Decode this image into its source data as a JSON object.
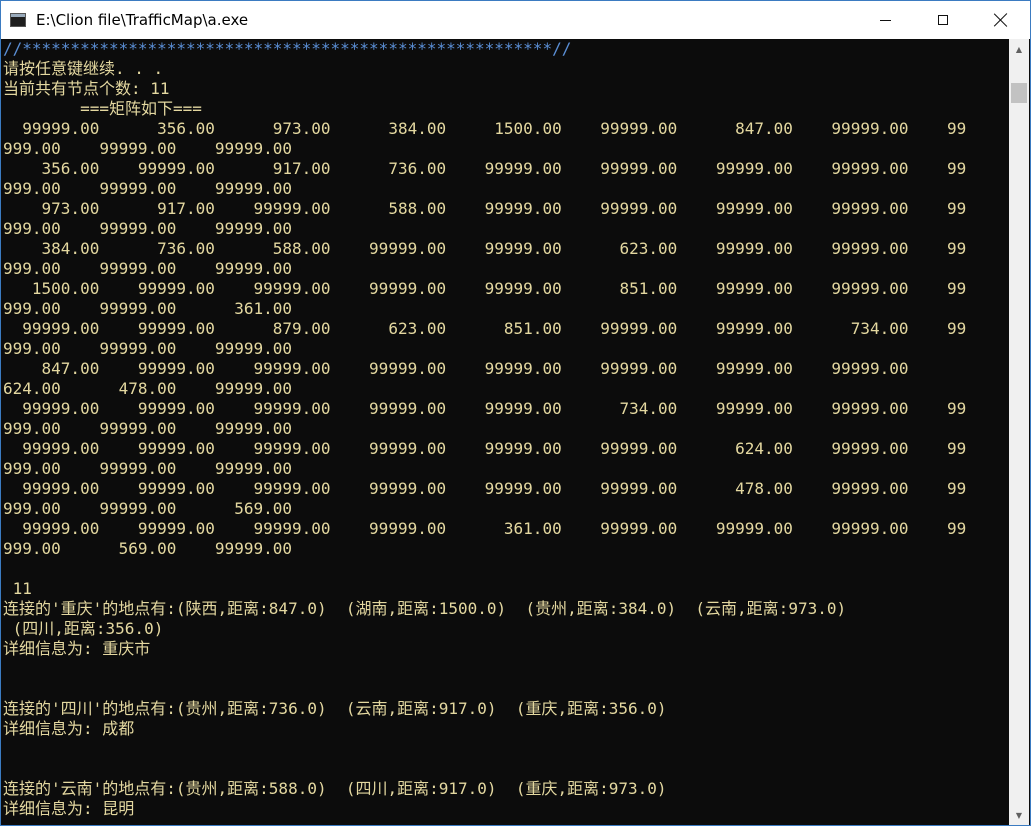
{
  "window": {
    "title": "E:\\Clion file\\TrafficMap\\a.exe",
    "minimize": "minimize",
    "maximize": "maximize",
    "close": "close"
  },
  "console": {
    "lines": [
      {
        "text": "//*******************************************************//",
        "style": "blue"
      },
      {
        "text": "请按任意键继续. . ."
      },
      {
        "text": "当前共有节点个数: 11"
      },
      {
        "text": "        ===矩阵如下==="
      },
      {
        "text": "  99999.00      356.00      973.00      384.00     1500.00    99999.00      847.00    99999.00    99"
      },
      {
        "text": "999.00    99999.00    99999.00"
      },
      {
        "text": "    356.00    99999.00      917.00      736.00    99999.00    99999.00    99999.00    99999.00    99"
      },
      {
        "text": "999.00    99999.00    99999.00"
      },
      {
        "text": "    973.00      917.00    99999.00      588.00    99999.00    99999.00    99999.00    99999.00    99"
      },
      {
        "text": "999.00    99999.00    99999.00"
      },
      {
        "text": "    384.00      736.00      588.00    99999.00    99999.00      623.00    99999.00    99999.00    99"
      },
      {
        "text": "999.00    99999.00    99999.00"
      },
      {
        "text": "   1500.00    99999.00    99999.00    99999.00    99999.00      851.00    99999.00    99999.00    99"
      },
      {
        "text": "999.00    99999.00      361.00"
      },
      {
        "text": "  99999.00    99999.00      879.00      623.00      851.00    99999.00    99999.00      734.00    99"
      },
      {
        "text": "999.00    99999.00    99999.00"
      },
      {
        "text": "    847.00    99999.00    99999.00    99999.00    99999.00    99999.00    99999.00    99999.00"
      },
      {
        "text": "624.00      478.00    99999.00"
      },
      {
        "text": "  99999.00    99999.00    99999.00    99999.00    99999.00      734.00    99999.00    99999.00    99"
      },
      {
        "text": "999.00    99999.00    99999.00"
      },
      {
        "text": "  99999.00    99999.00    99999.00    99999.00    99999.00    99999.00      624.00    99999.00    99"
      },
      {
        "text": "999.00    99999.00    99999.00"
      },
      {
        "text": "  99999.00    99999.00    99999.00    99999.00    99999.00    99999.00      478.00    99999.00    99"
      },
      {
        "text": "999.00    99999.00      569.00"
      },
      {
        "text": "  99999.00    99999.00    99999.00    99999.00      361.00    99999.00    99999.00    99999.00    99"
      },
      {
        "text": "999.00      569.00    99999.00"
      },
      {
        "text": ""
      },
      {
        "text": " 11"
      },
      {
        "text": "连接的'重庆'的地点有:(陕西,距离:847.0)  (湖南,距离:1500.0)  (贵州,距离:384.0)  (云南,距离:973.0)"
      },
      {
        "text": " (四川,距离:356.0)"
      },
      {
        "text": "详细信息为: 重庆市"
      },
      {
        "text": ""
      },
      {
        "text": ""
      },
      {
        "text": "连接的'四川'的地点有:(贵州,距离:736.0)  (云南,距离:917.0)  (重庆,距离:356.0)"
      },
      {
        "text": "详细信息为: 成都"
      },
      {
        "text": ""
      },
      {
        "text": ""
      },
      {
        "text": "连接的'云南'的地点有:(贵州,距离:588.0)  (四川,距离:917.0)  (重庆,距离:973.0)"
      },
      {
        "text": "详细信息为: 昆明"
      }
    ]
  },
  "scrollbar": {
    "up_arrow": "▲",
    "down_arrow": "▼"
  }
}
